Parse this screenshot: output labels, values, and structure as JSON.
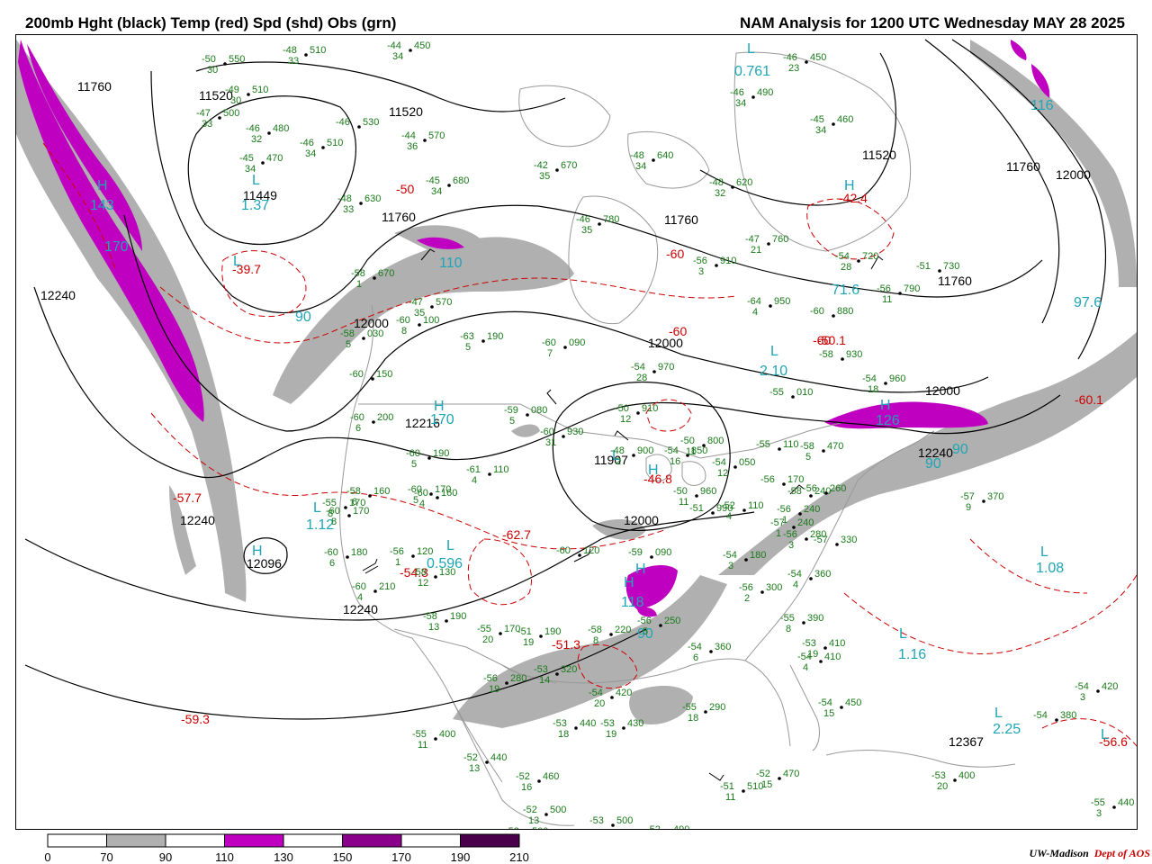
{
  "title": {
    "left": "200mb Hght (black) Temp (red) Spd (shd) Obs (grn)",
    "right": "NAM Analysis for 1200 UTC Wednesday  MAY 28 2025"
  },
  "credit": {
    "org": "UW-Madison",
    "dept": "Dept of AOS"
  },
  "colors": {
    "height": "#000000",
    "temp": "#cc0000",
    "speed_label": "#1fa5b5",
    "obs": "#1a7a1a",
    "border": "#999999",
    "shade_70_90": "#b0b0b0",
    "shade_110_130": "#c000c0",
    "shade_150_170": "#8a008a",
    "shade_190_210": "#4a004a"
  },
  "legend": {
    "ticks": [
      "0",
      "70",
      "90",
      "110",
      "130",
      "150",
      "170",
      "190",
      "210"
    ],
    "fills": [
      "#ffffff",
      "#b0b0b0",
      "#ffffff",
      "#c000c0",
      "#ffffff",
      "#8a008a",
      "#ffffff",
      "#4a004a"
    ]
  },
  "height_labels": [
    "11520",
    "11449",
    "11760",
    "12240",
    "11520",
    "11760",
    "12000",
    "12000",
    "12000",
    "11760",
    "12000",
    "12240",
    "12240",
    "12240",
    "11760",
    "12000",
    "12216",
    "11907",
    "12096",
    "12367",
    "11520",
    "11760"
  ],
  "speed_labels": [
    "0.761",
    "1.37",
    "143",
    "170",
    "90",
    "110",
    "90",
    "170",
    "2.10",
    "71.6",
    "97.6",
    "126",
    "90",
    "1.08",
    "1.12",
    "0.596",
    "118",
    "90",
    "1.16",
    "2.25",
    "116"
  ],
  "temp_labels": [
    "-39.7",
    "-42.4",
    "-50",
    "-57.7",
    "-62.7",
    "-46.8",
    "-54.3",
    "-51.3",
    "-59.3",
    "-56.6",
    "-60.1",
    "-60",
    "-60",
    "-60",
    "-50.1"
  ],
  "highs_lows": [
    "L",
    "L",
    "H",
    "L",
    "H",
    "L",
    "H",
    "L",
    "L",
    "H",
    "H",
    "L",
    "L",
    "H",
    "H",
    "L",
    "L",
    "L",
    "H"
  ],
  "obs": [
    [
      "-50",
      "550",
      "30"
    ],
    [
      "-48",
      "510",
      "33"
    ],
    [
      "-44",
      "450",
      "34"
    ],
    [
      "-49",
      "510",
      "30"
    ],
    [
      "-47",
      "500",
      "33"
    ],
    [
      "-46",
      "480",
      "32"
    ],
    [
      "-46",
      "510",
      "34"
    ],
    [
      "-45",
      "470",
      "34"
    ],
    [
      "-46",
      "530",
      ""
    ],
    [
      "-44",
      "570",
      "36"
    ],
    [
      "-45",
      "680",
      "34"
    ],
    [
      "-48",
      "630",
      "33"
    ],
    [
      "-47",
      "570",
      "35"
    ],
    [
      "-42",
      "670",
      "35"
    ],
    [
      "-48",
      "640",
      "34"
    ],
    [
      "-46",
      "490",
      "34"
    ],
    [
      "-45",
      "460",
      "34"
    ],
    [
      "-46",
      "450",
      "23"
    ],
    [
      "-48",
      "620",
      "32"
    ],
    [
      "-46",
      "780",
      "35"
    ],
    [
      "-47",
      "760",
      "21"
    ],
    [
      "-54",
      "720",
      "28"
    ],
    [
      "-51",
      "730",
      ""
    ],
    [
      "-56",
      "790",
      "11"
    ],
    [
      "-58",
      "670",
      "1"
    ],
    [
      "-60",
      "100",
      "8"
    ],
    [
      "-58",
      "030",
      "5"
    ],
    [
      "-60",
      "150",
      ""
    ],
    [
      "-63",
      "190",
      "5"
    ],
    [
      "-60",
      "090",
      "7"
    ],
    [
      "-54",
      "970",
      "28"
    ],
    [
      "-56",
      "910",
      "3"
    ],
    [
      "-64",
      "950",
      "4"
    ],
    [
      "-60",
      "880",
      ""
    ],
    [
      "-58",
      "930",
      ""
    ],
    [
      "-54",
      "960",
      "18"
    ],
    [
      "-55",
      "010",
      ""
    ],
    [
      "-59",
      "080",
      "5"
    ],
    [
      "-50",
      "910",
      "12"
    ],
    [
      "-60",
      "930",
      "31"
    ],
    [
      "-48",
      "900",
      "2"
    ],
    [
      "-54",
      "850",
      "16"
    ],
    [
      "-50",
      "800",
      "11"
    ],
    [
      "-54",
      "050",
      "12"
    ],
    [
      "-50",
      "960",
      "11"
    ],
    [
      "-55",
      "110",
      ""
    ],
    [
      "-58",
      "470",
      "5"
    ],
    [
      "-60",
      "200",
      "6"
    ],
    [
      "-60",
      "190",
      "5"
    ],
    [
      "-61",
      "110",
      "4"
    ],
    [
      "-60",
      "170",
      "5"
    ],
    [
      "-58",
      "160",
      "6"
    ],
    [
      "-60",
      "160",
      "4"
    ],
    [
      "-55",
      "170",
      "8"
    ],
    [
      "-60",
      "180",
      "6"
    ],
    [
      "-56",
      "120",
      "1"
    ],
    [
      "-58",
      "130",
      "12"
    ],
    [
      "-60",
      "210",
      "4"
    ],
    [
      "-60",
      "120",
      ""
    ],
    [
      "-59",
      "090",
      ""
    ],
    [
      "-51",
      "990",
      ""
    ],
    [
      "-52",
      "110",
      "4"
    ],
    [
      "-56",
      "170",
      ""
    ],
    [
      "-58",
      "240",
      ""
    ],
    [
      "-56",
      "260",
      ""
    ],
    [
      "-57",
      "240",
      "1"
    ],
    [
      "-56",
      "280",
      "3"
    ],
    [
      "-57",
      "330",
      ""
    ],
    [
      "-54",
      "180",
      "3"
    ],
    [
      "-58",
      "190",
      "13"
    ],
    [
      "-55",
      "170",
      "20"
    ],
    [
      "-51",
      "190",
      "19"
    ],
    [
      "-58",
      "220",
      "8"
    ],
    [
      "-56",
      "250",
      "5"
    ],
    [
      "-56",
      "300",
      "2"
    ],
    [
      "-54",
      "360",
      "4"
    ],
    [
      "-55",
      "390",
      "8"
    ],
    [
      "-53",
      "410",
      "19"
    ],
    [
      "-54",
      "410",
      "4"
    ],
    [
      "-54",
      "450",
      "15"
    ],
    [
      "-53",
      "320",
      "14"
    ],
    [
      "-54",
      "360",
      "6"
    ],
    [
      "-56",
      "280",
      "19"
    ],
    [
      "-54",
      "420",
      "20"
    ],
    [
      "-53",
      "440",
      "18"
    ],
    [
      "-53",
      "430",
      "19"
    ],
    [
      "-55",
      "400",
      "11"
    ],
    [
      "-52",
      "440",
      "13"
    ],
    [
      "-52",
      "460",
      "16"
    ],
    [
      "-52",
      "500",
      "13"
    ],
    [
      "-52",
      "470",
      "15"
    ],
    [
      "-51",
      "510",
      "11"
    ],
    [
      "-52",
      "500",
      ""
    ],
    [
      "-53",
      "500",
      ""
    ],
    [
      "-52",
      "490",
      ""
    ],
    [
      "-53",
      "400",
      "20"
    ],
    [
      "-54",
      "380",
      ""
    ],
    [
      "-54",
      "420",
      "3"
    ],
    [
      "-55",
      "440",
      "3"
    ],
    [
      "-57",
      "370",
      "9"
    ],
    [
      "-60",
      "170",
      "8"
    ],
    [
      "-55",
      "290",
      "18"
    ],
    [
      "-56",
      "240",
      "1"
    ]
  ]
}
